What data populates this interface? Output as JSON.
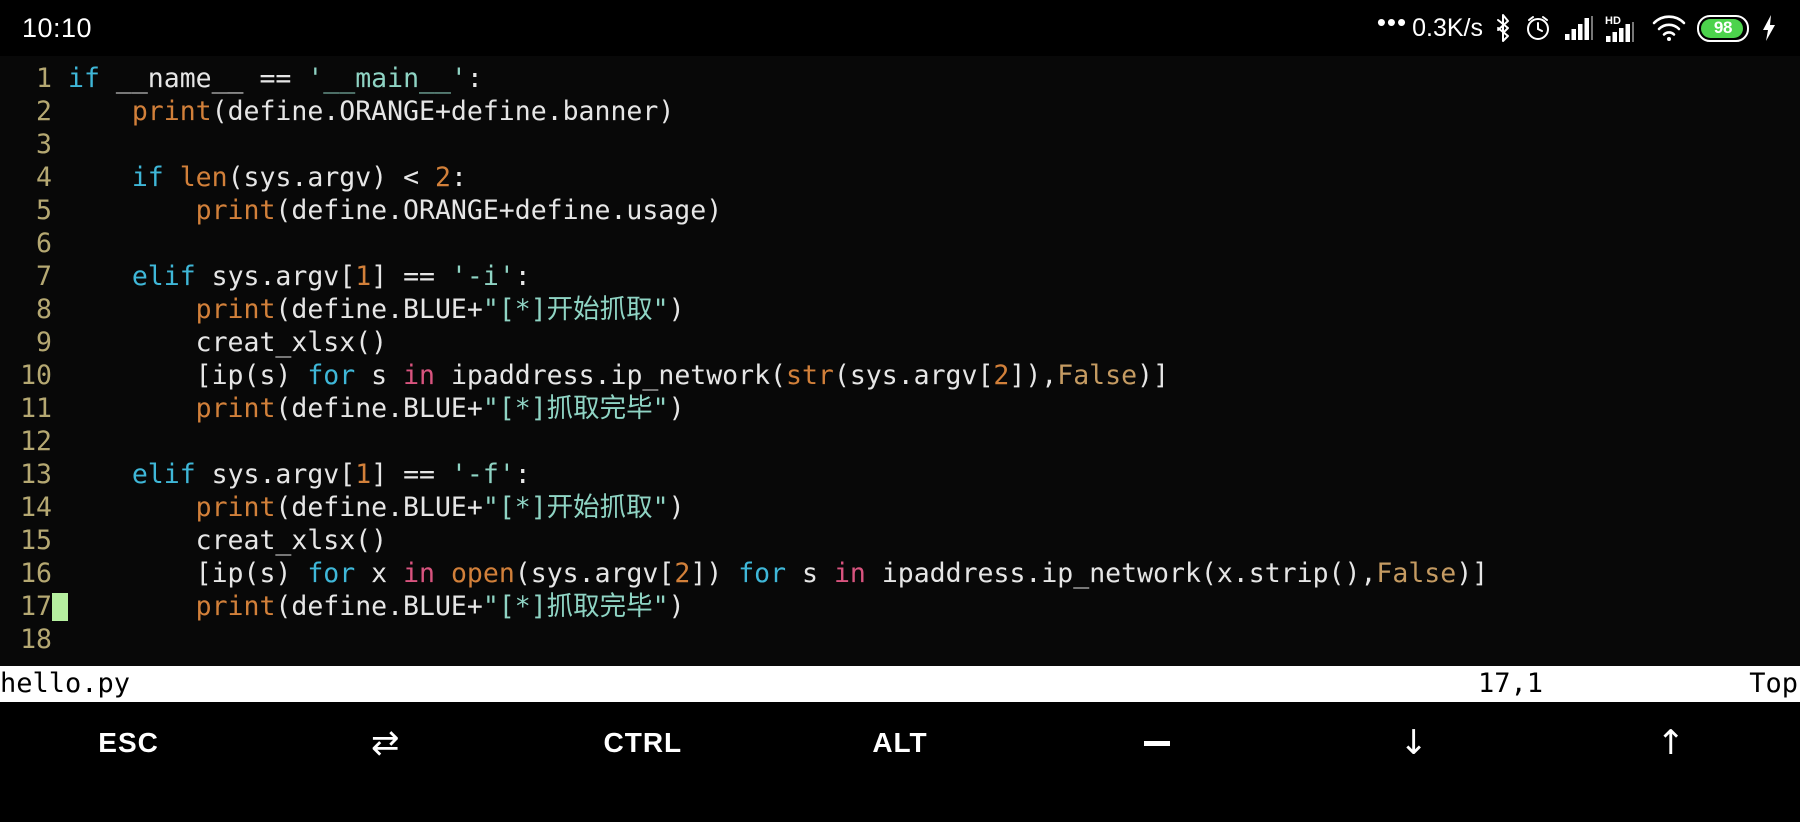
{
  "statusbar": {
    "clock": "10:10",
    "dots": "•••",
    "net_speed": "0.3K/s",
    "battery_percent": "98",
    "signal_hd_label": "HD",
    "icons": [
      "bluetooth-icon",
      "alarm-icon",
      "signal-1-icon",
      "signal-2-icon",
      "wifi-icon",
      "battery-icon",
      "charging-bolt-icon"
    ]
  },
  "editor": {
    "cursor_line": 17,
    "colors": {
      "background": "#080808",
      "line_number": "#b5a872",
      "text": "#e6e6e6",
      "keyword": "#3fb7d8",
      "operator_in": "#d9547f",
      "builtin": "#d2803a",
      "string": "#8fd4c4",
      "number": "#d2803a",
      "constant": "#c59b62",
      "cursor": "#b6f0a0"
    },
    "lines": [
      {
        "n": "1",
        "tokens": [
          {
            "t": "if",
            "c": "kw"
          },
          {
            "t": " __name__ == ",
            "c": "pl"
          },
          {
            "t": "'__main__'",
            "c": "str"
          },
          {
            "t": ":",
            "c": "pl"
          }
        ]
      },
      {
        "n": "2",
        "tokens": [
          {
            "t": "    ",
            "c": "pl"
          },
          {
            "t": "print",
            "c": "bi"
          },
          {
            "t": "(define.ORANGE+define.banner)",
            "c": "pl"
          }
        ]
      },
      {
        "n": "3",
        "tokens": []
      },
      {
        "n": "4",
        "tokens": [
          {
            "t": "    ",
            "c": "pl"
          },
          {
            "t": "if",
            "c": "kw"
          },
          {
            "t": " ",
            "c": "pl"
          },
          {
            "t": "len",
            "c": "bi"
          },
          {
            "t": "(sys.argv) < ",
            "c": "pl"
          },
          {
            "t": "2",
            "c": "num"
          },
          {
            "t": ":",
            "c": "pl"
          }
        ]
      },
      {
        "n": "5",
        "tokens": [
          {
            "t": "        ",
            "c": "pl"
          },
          {
            "t": "print",
            "c": "bi"
          },
          {
            "t": "(define.ORANGE+define.usage)",
            "c": "pl"
          }
        ]
      },
      {
        "n": "6",
        "tokens": []
      },
      {
        "n": "7",
        "tokens": [
          {
            "t": "    ",
            "c": "pl"
          },
          {
            "t": "elif",
            "c": "kw"
          },
          {
            "t": " sys.argv[",
            "c": "pl"
          },
          {
            "t": "1",
            "c": "num"
          },
          {
            "t": "] == ",
            "c": "pl"
          },
          {
            "t": "'-i'",
            "c": "str"
          },
          {
            "t": ":",
            "c": "pl"
          }
        ]
      },
      {
        "n": "8",
        "tokens": [
          {
            "t": "        ",
            "c": "pl"
          },
          {
            "t": "print",
            "c": "bi"
          },
          {
            "t": "(define.BLUE+",
            "c": "pl"
          },
          {
            "t": "\"[*]开始抓取\"",
            "c": "str"
          },
          {
            "t": ")",
            "c": "pl"
          }
        ]
      },
      {
        "n": "9",
        "tokens": [
          {
            "t": "        creat_xlsx()",
            "c": "pl"
          }
        ]
      },
      {
        "n": "10",
        "tokens": [
          {
            "t": "        [ip(s) ",
            "c": "pl"
          },
          {
            "t": "for",
            "c": "kw"
          },
          {
            "t": " s ",
            "c": "pl"
          },
          {
            "t": "in",
            "c": "in"
          },
          {
            "t": " ipaddress.ip_network(",
            "c": "pl"
          },
          {
            "t": "str",
            "c": "bi"
          },
          {
            "t": "(sys.argv[",
            "c": "pl"
          },
          {
            "t": "2",
            "c": "num"
          },
          {
            "t": "]),",
            "c": "pl"
          },
          {
            "t": "False",
            "c": "cons"
          },
          {
            "t": ")]",
            "c": "pl"
          }
        ]
      },
      {
        "n": "11",
        "tokens": [
          {
            "t": "        ",
            "c": "pl"
          },
          {
            "t": "print",
            "c": "bi"
          },
          {
            "t": "(define.BLUE+",
            "c": "pl"
          },
          {
            "t": "\"[*]抓取完毕\"",
            "c": "str"
          },
          {
            "t": ")",
            "c": "pl"
          }
        ]
      },
      {
        "n": "12",
        "tokens": []
      },
      {
        "n": "13",
        "tokens": [
          {
            "t": "    ",
            "c": "pl"
          },
          {
            "t": "elif",
            "c": "kw"
          },
          {
            "t": " sys.argv[",
            "c": "pl"
          },
          {
            "t": "1",
            "c": "num"
          },
          {
            "t": "] == ",
            "c": "pl"
          },
          {
            "t": "'-f'",
            "c": "str"
          },
          {
            "t": ":",
            "c": "pl"
          }
        ]
      },
      {
        "n": "14",
        "tokens": [
          {
            "t": "        ",
            "c": "pl"
          },
          {
            "t": "print",
            "c": "bi"
          },
          {
            "t": "(define.BLUE+",
            "c": "pl"
          },
          {
            "t": "\"[*]开始抓取\"",
            "c": "str"
          },
          {
            "t": ")",
            "c": "pl"
          }
        ]
      },
      {
        "n": "15",
        "tokens": [
          {
            "t": "        creat_xlsx()",
            "c": "pl"
          }
        ]
      },
      {
        "n": "16",
        "tokens": [
          {
            "t": "        [ip(s) ",
            "c": "pl"
          },
          {
            "t": "for",
            "c": "kw"
          },
          {
            "t": " x ",
            "c": "pl"
          },
          {
            "t": "in",
            "c": "in"
          },
          {
            "t": " ",
            "c": "pl"
          },
          {
            "t": "open",
            "c": "bi"
          },
          {
            "t": "(sys.argv[",
            "c": "pl"
          },
          {
            "t": "2",
            "c": "num"
          },
          {
            "t": "]) ",
            "c": "pl"
          },
          {
            "t": "for",
            "c": "kw"
          },
          {
            "t": " s ",
            "c": "pl"
          },
          {
            "t": "in",
            "c": "in"
          },
          {
            "t": " ipaddress.ip_network(x.strip(),",
            "c": "pl"
          },
          {
            "t": "False",
            "c": "cons"
          },
          {
            "t": ")]",
            "c": "pl"
          }
        ]
      },
      {
        "n": "17",
        "tokens": [
          {
            "t": "        ",
            "c": "pl"
          },
          {
            "t": "print",
            "c": "bi"
          },
          {
            "t": "(define.BLUE+",
            "c": "pl"
          },
          {
            "t": "\"[*]抓取完毕\"",
            "c": "str"
          },
          {
            "t": ")",
            "c": "pl"
          }
        ]
      },
      {
        "n": "18",
        "tokens": []
      }
    ]
  },
  "vim_status": {
    "filename": "hello.py",
    "position": "17,1",
    "scroll": "Top"
  },
  "toolbar": {
    "keys": [
      {
        "label": "ESC",
        "icon": null,
        "name": "esc-key"
      },
      {
        "label": "",
        "icon": "tab-icon",
        "name": "tab-key"
      },
      {
        "label": "CTRL",
        "icon": null,
        "name": "ctrl-key"
      },
      {
        "label": "ALT",
        "icon": null,
        "name": "alt-key"
      },
      {
        "label": "",
        "icon": "minus-icon",
        "name": "minus-key"
      },
      {
        "label": "",
        "icon": "arrow-down-icon",
        "name": "arrow-down-key"
      },
      {
        "label": "",
        "icon": "arrow-up-icon",
        "name": "arrow-up-key"
      }
    ]
  }
}
